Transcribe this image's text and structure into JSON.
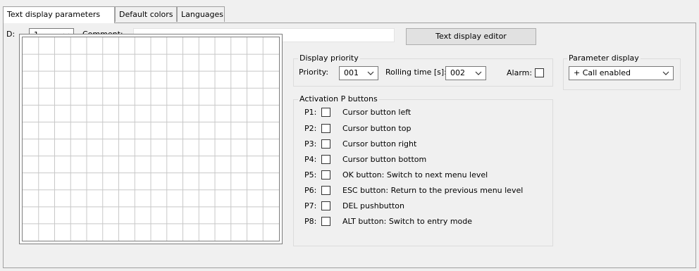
{
  "tabs": [
    {
      "label": "Text display parameters",
      "active": true
    },
    {
      "label": "Default colors",
      "active": false
    },
    {
      "label": "Languages",
      "active": false
    }
  ],
  "header": {
    "d_label": "D:",
    "d_value": "1",
    "comment_label": "Comment:",
    "comment_value": "",
    "editor_button": "Text display editor"
  },
  "display_grid": {
    "columns": 16,
    "rows": 12
  },
  "display_priority": {
    "legend": "Display priority",
    "priority_label": "Priority:",
    "priority_value": "001",
    "rolling_label": "Rolling time [s]:",
    "rolling_value": "002",
    "alarm_label": "Alarm:",
    "alarm_checked": false
  },
  "parameter_display": {
    "legend": "Parameter display",
    "value": "+ Call enabled"
  },
  "activation": {
    "legend": "Activation P buttons",
    "items": [
      {
        "key": "P1:",
        "label": "Cursor button left",
        "checked": false
      },
      {
        "key": "P2:",
        "label": "Cursor button top",
        "checked": false
      },
      {
        "key": "P3:",
        "label": "Cursor button right",
        "checked": false
      },
      {
        "key": "P4:",
        "label": "Cursor button bottom",
        "checked": false
      },
      {
        "key": "P5:",
        "label": "OK button: Switch to next menu level",
        "checked": false
      },
      {
        "key": "P6:",
        "label": "ESC button: Return to the previous menu level",
        "checked": false
      },
      {
        "key": "P7:",
        "label": "DEL pushbutton",
        "checked": false
      },
      {
        "key": "P8:",
        "label": "ALT button: Switch to entry mode",
        "checked": false
      }
    ]
  },
  "icons": {
    "dropdown": "chevron-down-icon"
  }
}
